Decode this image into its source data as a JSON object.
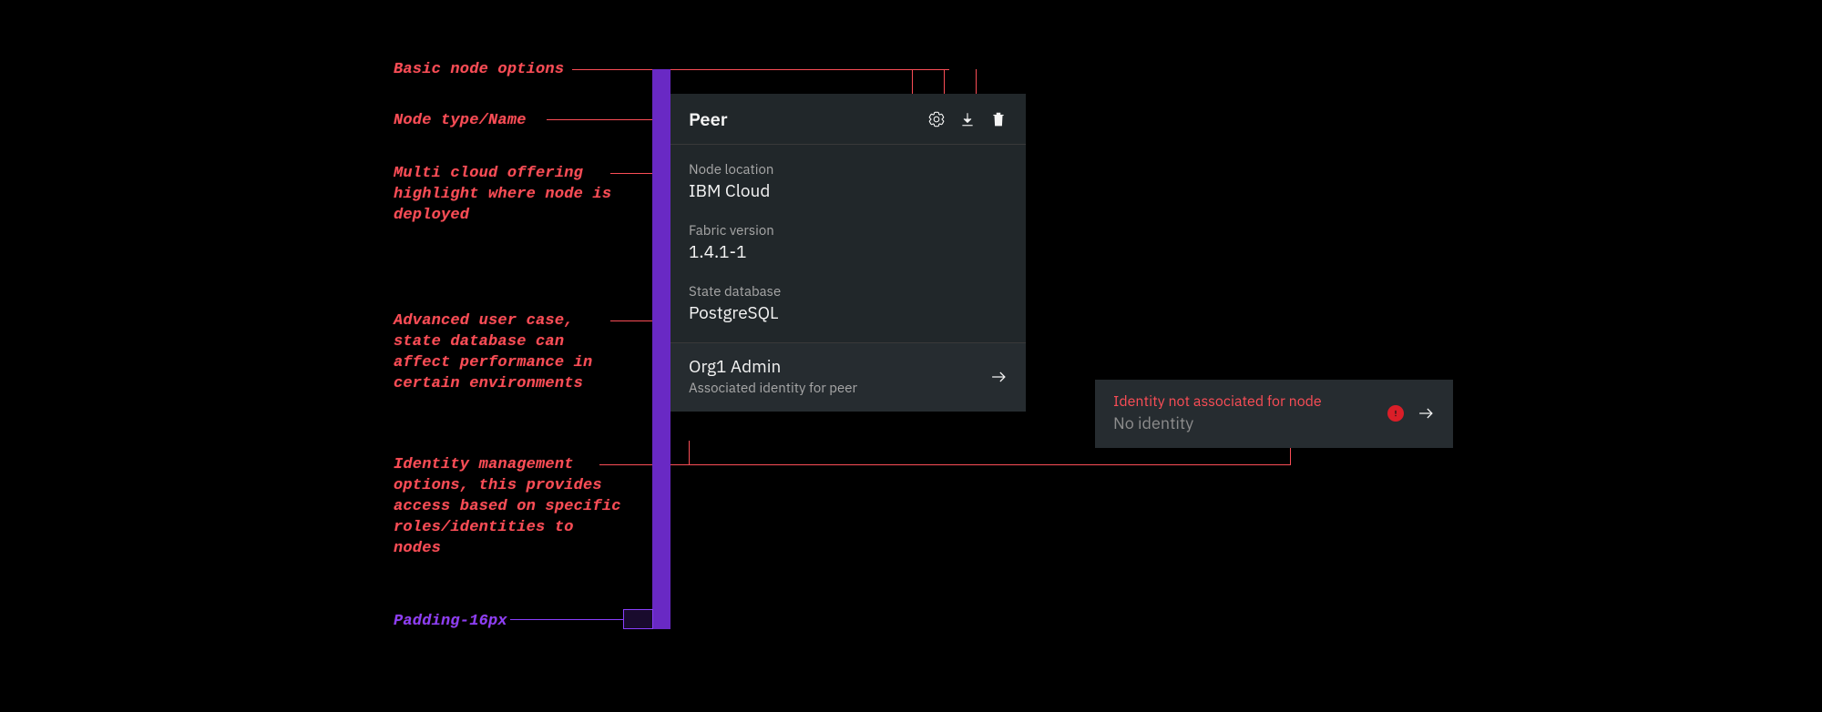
{
  "annotations": {
    "basic_options": "Basic node options",
    "node_type": "Node type/Name",
    "multi_cloud": "Multi cloud offering highlight where node is deployed",
    "advanced": "Advanced user case, state database can affect performance in certain environments",
    "identity": "Identity management options, this provides access based on specific roles/identities to nodes",
    "padding": "Padding-16px"
  },
  "card": {
    "title": "Peer",
    "fields": {
      "node_location": {
        "label": "Node location",
        "value": "IBM Cloud"
      },
      "fabric_version": {
        "label": "Fabric version",
        "value": "1.4.1-1"
      },
      "state_database": {
        "label": "State database",
        "value": "PostgreSQL"
      }
    },
    "footer": {
      "title": "Org1 Admin",
      "sub": "Associated identity for peer"
    }
  },
  "error_panel": {
    "title": "Identity not associated for node",
    "sub": "No identity"
  },
  "icons": {
    "settings": "gear-icon",
    "download": "download-icon",
    "delete": "trash-icon",
    "arrow": "arrow-right-icon",
    "alert": "warning-filled-icon"
  },
  "colors": {
    "accent": "#6929c4",
    "alert": "#fa4d56",
    "bg_panel": "#21272a"
  }
}
